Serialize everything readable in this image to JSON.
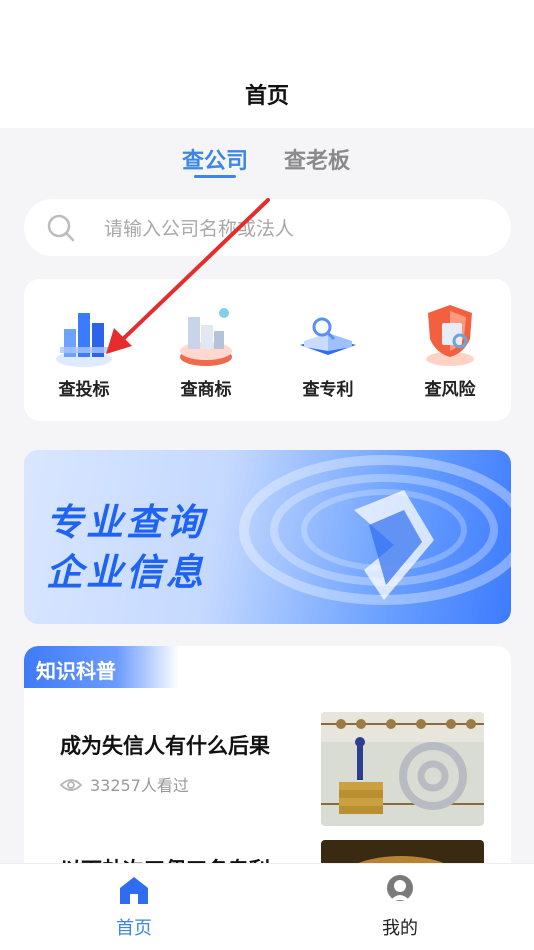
{
  "header": {
    "title": "首页"
  },
  "tabs": [
    {
      "label": "查公司",
      "active": true
    },
    {
      "label": "查老板",
      "active": false
    }
  ],
  "search": {
    "placeholder": "请输入公司名称或法人",
    "icon": "search-icon"
  },
  "quick_actions": [
    {
      "label": "查投标",
      "icon": "bid-chart-icon"
    },
    {
      "label": "查商标",
      "icon": "trademark-icon"
    },
    {
      "label": "查专利",
      "icon": "patent-book-icon"
    },
    {
      "label": "查风险",
      "icon": "risk-shield-icon"
    }
  ],
  "banner": {
    "line1": "专业查询",
    "line2": "企业信息"
  },
  "knowledge": {
    "heading": "知识科普",
    "articles": [
      {
        "title": "成为失信人有什么后果",
        "views": "33257人看过",
        "thumb": "coins-abacus-image"
      },
      {
        "title": "以下劫次工伊工名专利",
        "views": "",
        "thumb": "gold-light-image"
      }
    ]
  },
  "tabbar": {
    "items": [
      {
        "label": "首页",
        "icon": "home-icon",
        "active": true
      },
      {
        "label": "我的",
        "icon": "profile-icon",
        "active": false
      }
    ]
  },
  "colors": {
    "accent": "#3b86e6",
    "brand_blue": "#1f63f2",
    "annotation_arrow": "#e62d2d"
  }
}
